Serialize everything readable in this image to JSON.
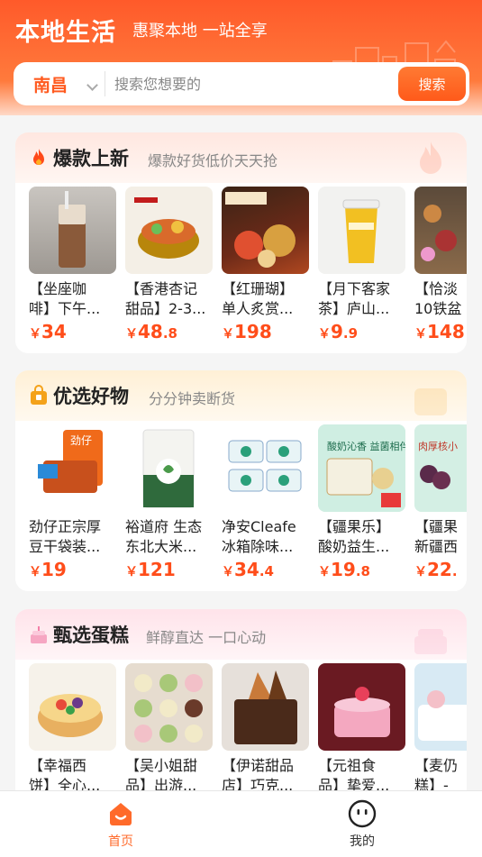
{
  "header": {
    "app_title": "本地生活",
    "slogan": "惠聚本地 一站全享",
    "city": "南昌",
    "search_placeholder": "搜索您想要的",
    "search_button": "搜索",
    "brand_color": "#ff5a1f"
  },
  "sections": [
    {
      "title": "爆款上新",
      "subtitle": "爆款好货低价天天抢",
      "icon": "flame-icon",
      "items": [
        {
          "name1": "【坐座咖",
          "name2": "啡】下午...",
          "yen": "￥",
          "int": "34",
          "dec": ""
        },
        {
          "name1": "【香港杏记",
          "name2": "甜品】2-3...",
          "yen": "￥",
          "int": "48",
          "dec": ".8"
        },
        {
          "name1": "【红珊瑚】",
          "name2": "单人炙赏...",
          "yen": "￥",
          "int": "198",
          "dec": ""
        },
        {
          "name1": "【月下客家",
          "name2": "茶】庐山...",
          "yen": "￥",
          "int": "9",
          "dec": ".9"
        },
        {
          "name1": "【恰淡",
          "name2": "10铁盆",
          "yen": "￥",
          "int": "148",
          "dec": ""
        }
      ]
    },
    {
      "title": "优选好物",
      "subtitle": "分分钟卖断货",
      "icon": "shopping-bag-icon",
      "items": [
        {
          "name1": "劲仔正宗厚",
          "name2": "豆干袋装...",
          "yen": "￥",
          "int": "19",
          "dec": ""
        },
        {
          "name1": "裕道府 生态",
          "name2": "东北大米...",
          "yen": "￥",
          "int": "121",
          "dec": ""
        },
        {
          "name1": "净安Cleafe",
          "name2": "冰箱除味...",
          "yen": "￥",
          "int": "34",
          "dec": ".4"
        },
        {
          "name1": "【疆果乐】",
          "name2": "酸奶益生...",
          "yen": "￥",
          "int": "19",
          "dec": ".8"
        },
        {
          "name1": "【疆果",
          "name2": "新疆西",
          "yen": "￥",
          "int": "22",
          "dec": "."
        }
      ]
    },
    {
      "title": "甄选蛋糕",
      "subtitle": "鲜醇直达 一口心动",
      "icon": "cake-icon",
      "items": [
        {
          "name1": "【幸福西",
          "name2": "饼】全心...",
          "yen": "",
          "int": "",
          "dec": ""
        },
        {
          "name1": "【吴小姐甜",
          "name2": "品】出游...",
          "yen": "",
          "int": "",
          "dec": ""
        },
        {
          "name1": "【伊诺甜品",
          "name2": "店】巧克...",
          "yen": "",
          "int": "",
          "dec": ""
        },
        {
          "name1": "【元祖食",
          "name2": "品】挚爱...",
          "yen": "",
          "int": "",
          "dec": ""
        },
        {
          "name1": "【麦仍",
          "name2": "糕】-",
          "yen": "",
          "int": "",
          "dec": ""
        }
      ]
    }
  ],
  "tabbar": {
    "home_label": "首页",
    "mine_label": "我的",
    "active_color": "#ff6a2a"
  }
}
